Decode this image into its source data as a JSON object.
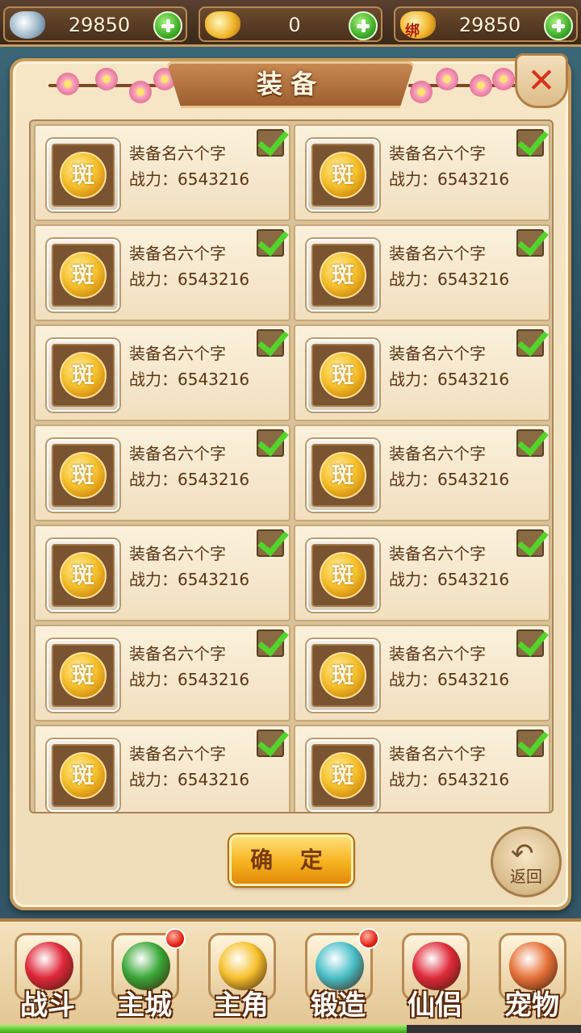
{
  "currency": {
    "silver": {
      "value": "29850",
      "icon": "silver-ingot-icon"
    },
    "gold": {
      "value": "0",
      "icon": "gold-ingot-icon"
    },
    "bound_gold": {
      "value": "29850",
      "icon": "bound-gold-icon",
      "badge": "绑"
    }
  },
  "panel": {
    "title": "装备",
    "close_icon": "close-icon"
  },
  "items": [
    {
      "name": "装备名六个字",
      "power_label": "战力：",
      "power": "6543216",
      "glyph": "斑",
      "checked": true
    },
    {
      "name": "装备名六个字",
      "power_label": "战力：",
      "power": "6543216",
      "glyph": "斑",
      "checked": true
    },
    {
      "name": "装备名六个字",
      "power_label": "战力：",
      "power": "6543216",
      "glyph": "斑",
      "checked": true
    },
    {
      "name": "装备名六个字",
      "power_label": "战力：",
      "power": "6543216",
      "glyph": "斑",
      "checked": true
    },
    {
      "name": "装备名六个字",
      "power_label": "战力：",
      "power": "6543216",
      "glyph": "斑",
      "checked": true
    },
    {
      "name": "装备名六个字",
      "power_label": "战力：",
      "power": "6543216",
      "glyph": "斑",
      "checked": true
    },
    {
      "name": "装备名六个字",
      "power_label": "战力：",
      "power": "6543216",
      "glyph": "斑",
      "checked": true
    },
    {
      "name": "装备名六个字",
      "power_label": "战力：",
      "power": "6543216",
      "glyph": "斑",
      "checked": true
    },
    {
      "name": "装备名六个字",
      "power_label": "战力：",
      "power": "6543216",
      "glyph": "斑",
      "checked": true
    },
    {
      "name": "装备名六个字",
      "power_label": "战力：",
      "power": "6543216",
      "glyph": "斑",
      "checked": true
    },
    {
      "name": "装备名六个字",
      "power_label": "战力：",
      "power": "6543216",
      "glyph": "斑",
      "checked": true
    },
    {
      "name": "装备名六个字",
      "power_label": "战力：",
      "power": "6543216",
      "glyph": "斑",
      "checked": true
    },
    {
      "name": "装备名六个字",
      "power_label": "战力：",
      "power": "6543216",
      "glyph": "斑",
      "checked": true
    },
    {
      "name": "装备名六个字",
      "power_label": "战力：",
      "power": "6543216",
      "glyph": "斑",
      "checked": true
    }
  ],
  "buttons": {
    "confirm": "确 定",
    "back": "返回"
  },
  "nav": [
    {
      "label": "战斗",
      "icon": "battle-icon",
      "color": "#e0283a",
      "dot": false
    },
    {
      "label": "主城",
      "icon": "city-icon",
      "color": "#3aa838",
      "dot": true
    },
    {
      "label": "主角",
      "icon": "hero-icon",
      "color": "#f6c22e",
      "dot": false
    },
    {
      "label": "锻造",
      "icon": "forge-hammer-icon",
      "color": "#4ac0c8",
      "dot": true
    },
    {
      "label": "仙侣",
      "icon": "partner-heart-icon",
      "color": "#e02a3a",
      "dot": false
    },
    {
      "label": "宠物",
      "icon": "pet-monkey-icon",
      "color": "#e8733a",
      "dot": false
    }
  ],
  "xp_progress": 0.7
}
